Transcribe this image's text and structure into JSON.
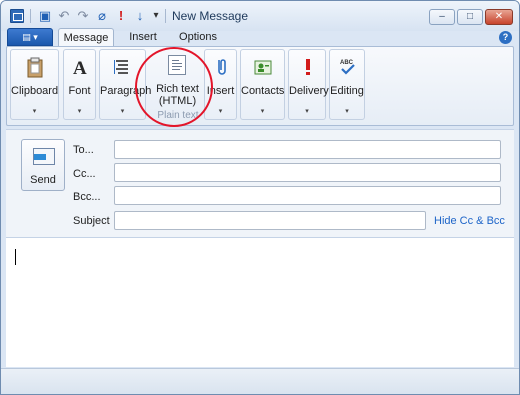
{
  "window": {
    "title": "New Message"
  },
  "quick_access": [
    {
      "icon": "save-icon",
      "glyph": "▣"
    },
    {
      "icon": "undo-icon",
      "glyph": "↶"
    },
    {
      "icon": "redo-icon",
      "glyph": "↷"
    },
    {
      "icon": "attach-icon",
      "glyph": "⌀"
    },
    {
      "icon": "high-priority-icon",
      "glyph": "!"
    },
    {
      "icon": "low-priority-icon",
      "glyph": "↓"
    },
    {
      "icon": "customize-icon",
      "glyph": "▾"
    }
  ],
  "window_controls": {
    "minimize": "–",
    "maximize": "□",
    "close": "✕"
  },
  "tabs": {
    "message": "Message",
    "insert": "Insert",
    "options": "Options"
  },
  "help": "?",
  "ribbon": {
    "clipboard": "Clipboard",
    "font": "Font",
    "paragraph": "Paragraph",
    "rich_text_line1": "Rich text",
    "rich_text_line2": "(HTML)",
    "plain_text": "Plain text",
    "insert": "Insert",
    "contacts": "Contacts",
    "delivery": "Delivery",
    "editing": "Editing",
    "dropdown_glyph": "▾"
  },
  "compose": {
    "send": "Send",
    "to_label": "To...",
    "cc_label": "Cc...",
    "bcc_label": "Bcc...",
    "subject_label": "Subject",
    "to_value": "",
    "cc_value": "",
    "bcc_value": "",
    "subject_value": "",
    "hide_cc_bcc": "Hide Cc & Bcc"
  },
  "colors": {
    "accent": "#2d6fc3",
    "link": "#1d64c8",
    "annotation_circle": "#e3152a"
  }
}
